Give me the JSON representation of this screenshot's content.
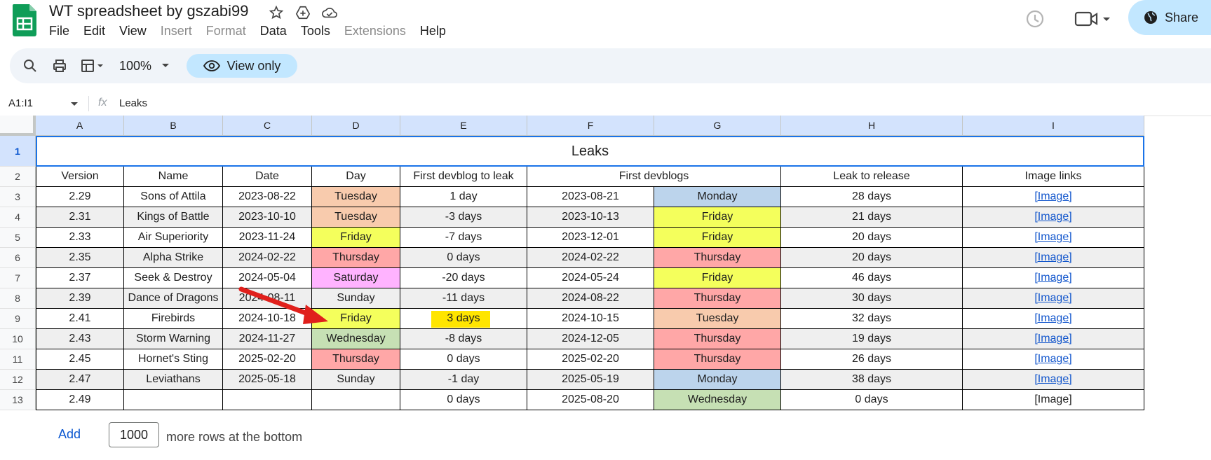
{
  "doc": {
    "title": "WT spreadsheet by gszabi99",
    "share_label": "Share"
  },
  "menu": [
    "File",
    "Edit",
    "View",
    "Insert",
    "Format",
    "Data",
    "Tools",
    "Extensions",
    "Help"
  ],
  "menu_disabled": [
    false,
    false,
    false,
    true,
    true,
    false,
    false,
    true,
    false
  ],
  "toolbar": {
    "zoom": "100%",
    "view_only": "View only"
  },
  "formula_bar": {
    "name_box": "A1:I1",
    "fx": "fx",
    "value": "Leaks"
  },
  "columns": [
    "A",
    "B",
    "C",
    "D",
    "E",
    "F",
    "G",
    "H",
    "I"
  ],
  "row_numbers": [
    "1",
    "2",
    "3",
    "4",
    "5",
    "6",
    "7",
    "8",
    "9",
    "10",
    "11",
    "12",
    "13"
  ],
  "title_cell": "Leaks",
  "headers": [
    "Version",
    "Name",
    "Date",
    "Day",
    "First devblog to leak",
    "First devblogs",
    "",
    "Leak to release",
    "Image links"
  ],
  "rows": [
    {
      "version": "2.29",
      "name": "Sons of Attila",
      "date": "2023-08-22",
      "day": "Tuesday",
      "dev_to_leak": "1 day",
      "devblog_date": "2023-08-21",
      "devblog_day": "Monday",
      "leak_to_release": "28 days",
      "image": "[Image]"
    },
    {
      "version": "2.31",
      "name": "Kings of Battle",
      "date": "2023-10-10",
      "day": "Tuesday",
      "dev_to_leak": "-3 days",
      "devblog_date": "2023-10-13",
      "devblog_day": "Friday",
      "leak_to_release": "21 days",
      "image": "[Image]"
    },
    {
      "version": "2.33",
      "name": "Air Superiority",
      "date": "2023-11-24",
      "day": "Friday",
      "dev_to_leak": "-7 days",
      "devblog_date": "2023-12-01",
      "devblog_day": "Friday",
      "leak_to_release": "20 days",
      "image": "[Image]"
    },
    {
      "version": "2.35",
      "name": "Alpha Strike",
      "date": "2024-02-22",
      "day": "Thursday",
      "dev_to_leak": "0 days",
      "devblog_date": "2024-02-22",
      "devblog_day": "Thursday",
      "leak_to_release": "20 days",
      "image": "[Image]"
    },
    {
      "version": "2.37",
      "name": "Seek & Destroy",
      "date": "2024-05-04",
      "day": "Saturday",
      "dev_to_leak": "-20 days",
      "devblog_date": "2024-05-24",
      "devblog_day": "Friday",
      "leak_to_release": "46 days",
      "image": "[Image]"
    },
    {
      "version": "2.39",
      "name": "Dance of Dragons",
      "date": "2024-08-11",
      "day": "Sunday",
      "dev_to_leak": "-11 days",
      "devblog_date": "2024-08-22",
      "devblog_day": "Thursday",
      "leak_to_release": "30 days",
      "image": "[Image]"
    },
    {
      "version": "2.41",
      "name": "Firebirds",
      "date": "2024-10-18",
      "day": "Friday",
      "dev_to_leak": "3 days",
      "devblog_date": "2024-10-15",
      "devblog_day": "Tuesday",
      "leak_to_release": "32 days",
      "image": "[Image]"
    },
    {
      "version": "2.43",
      "name": "Storm Warning",
      "date": "2024-11-27",
      "day": "Wednesday",
      "dev_to_leak": "-8 days",
      "devblog_date": "2024-12-05",
      "devblog_day": "Thursday",
      "leak_to_release": "19 days",
      "image": "[Image]"
    },
    {
      "version": "2.45",
      "name": "Hornet's Sting",
      "date": "2025-02-20",
      "day": "Thursday",
      "dev_to_leak": "0 days",
      "devblog_date": "2025-02-20",
      "devblog_day": "Thursday",
      "leak_to_release": "26 days",
      "image": "[Image]"
    },
    {
      "version": "2.47",
      "name": "Leviathans",
      "date": "2025-05-18",
      "day": "Sunday",
      "dev_to_leak": "-1 day",
      "devblog_date": "2025-05-19",
      "devblog_day": "Monday",
      "leak_to_release": "38 days",
      "image": "[Image]"
    },
    {
      "version": "2.49",
      "name": "",
      "date": "",
      "day": "",
      "dev_to_leak": "0 days",
      "devblog_date": "2025-08-20",
      "devblog_day": "Wednesday",
      "leak_to_release": "0 days",
      "image": "[Image]"
    }
  ],
  "day_colors": {
    "Monday": "#bcd4ec",
    "Tuesday": "#f8cbad",
    "Wednesday": "#c6e0b4",
    "Thursday": "#ffa7a7",
    "Friday": "#f4ff5c",
    "Saturday": "#ffb3ff",
    "Sunday": "#ffffff"
  },
  "link_rows_count": 10,
  "footer": {
    "add_label": "Add",
    "rows_value": "1000",
    "more_text": "more rows at the bottom"
  },
  "colors": {
    "accent": "#0b57d0",
    "share_bg": "#c2e7ff",
    "col_header_bg": "#d3e3fd",
    "highlight": "#ffe500",
    "arrow": "#e0201c"
  }
}
